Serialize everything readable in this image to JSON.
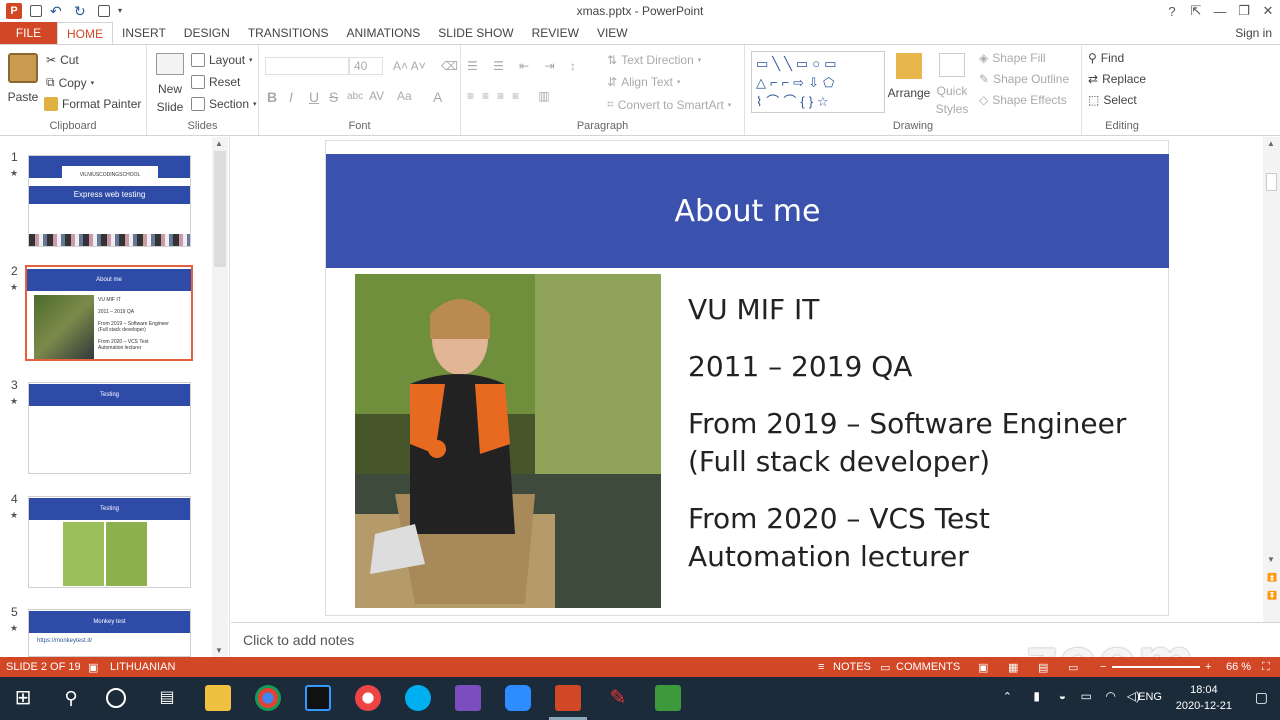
{
  "window": {
    "title": "xmas.pptx - PowerPoint",
    "help": "?",
    "signin": "Sign in"
  },
  "tabs": [
    "FILE",
    "HOME",
    "INSERT",
    "DESIGN",
    "TRANSITIONS",
    "ANIMATIONS",
    "SLIDE SHOW",
    "REVIEW",
    "VIEW"
  ],
  "ribbon": {
    "clipboard": {
      "paste": "Paste",
      "cut": "Cut",
      "copy": "Copy",
      "format_painter": "Format Painter",
      "label": "Clipboard"
    },
    "slides": {
      "new_slide_1": "New",
      "new_slide_2": "Slide",
      "layout": "Layout",
      "reset": "Reset",
      "section": "Section",
      "label": "Slides"
    },
    "font": {
      "size": "40",
      "label": "Font",
      "bold": "B",
      "italic": "I",
      "underline": "U",
      "strike": "S",
      "shadow": "abc",
      "spacing": "AV",
      "case": "Aa",
      "color": "A"
    },
    "paragraph": {
      "text_direction": "Text Direction",
      "align_text": "Align Text",
      "smartart": "Convert to SmartArt",
      "label": "Paragraph"
    },
    "drawing": {
      "arrange": "Arrange",
      "quick_1": "Quick",
      "quick_2": "Styles",
      "fill": "Shape Fill",
      "outline": "Shape Outline",
      "effects": "Shape Effects",
      "label": "Drawing"
    },
    "editing": {
      "find": "Find",
      "replace": "Replace",
      "select": "Select",
      "label": "Editing"
    }
  },
  "thumbs": [
    {
      "num": "1",
      "title": "Express web testing",
      "logo": "VILNIUSCODINGSCHOOL"
    },
    {
      "num": "2",
      "title": "About me",
      "lines": [
        "VU MIF IT",
        "2011 – 2019 QA",
        "From 2019 – Software Engineer",
        "(Full stack developer)",
        "From 2020 – VCS Test",
        "Automation lecturer"
      ]
    },
    {
      "num": "3",
      "title": "Testing"
    },
    {
      "num": "4",
      "title": "Testing"
    },
    {
      "num": "5",
      "title": "Monkey test",
      "link": "https://monkeytest.it/"
    }
  ],
  "slide": {
    "title": "About me",
    "lines": [
      "VU MIF IT",
      "2011 – 2019 QA",
      "From 2019 – Software Engineer (Full stack developer)",
      "From 2020 – VCS Test Automation lecturer"
    ]
  },
  "notes_placeholder": "Click to add notes",
  "status": {
    "slide": "SLIDE 2 OF 19",
    "language": "LITHUANIAN",
    "notes": "NOTES",
    "comments": "COMMENTS",
    "zoom": "66 %"
  },
  "taskbar": {
    "lang": "ENG",
    "time": "18:04",
    "date": "2020-12-21"
  },
  "watermark": "zoom"
}
